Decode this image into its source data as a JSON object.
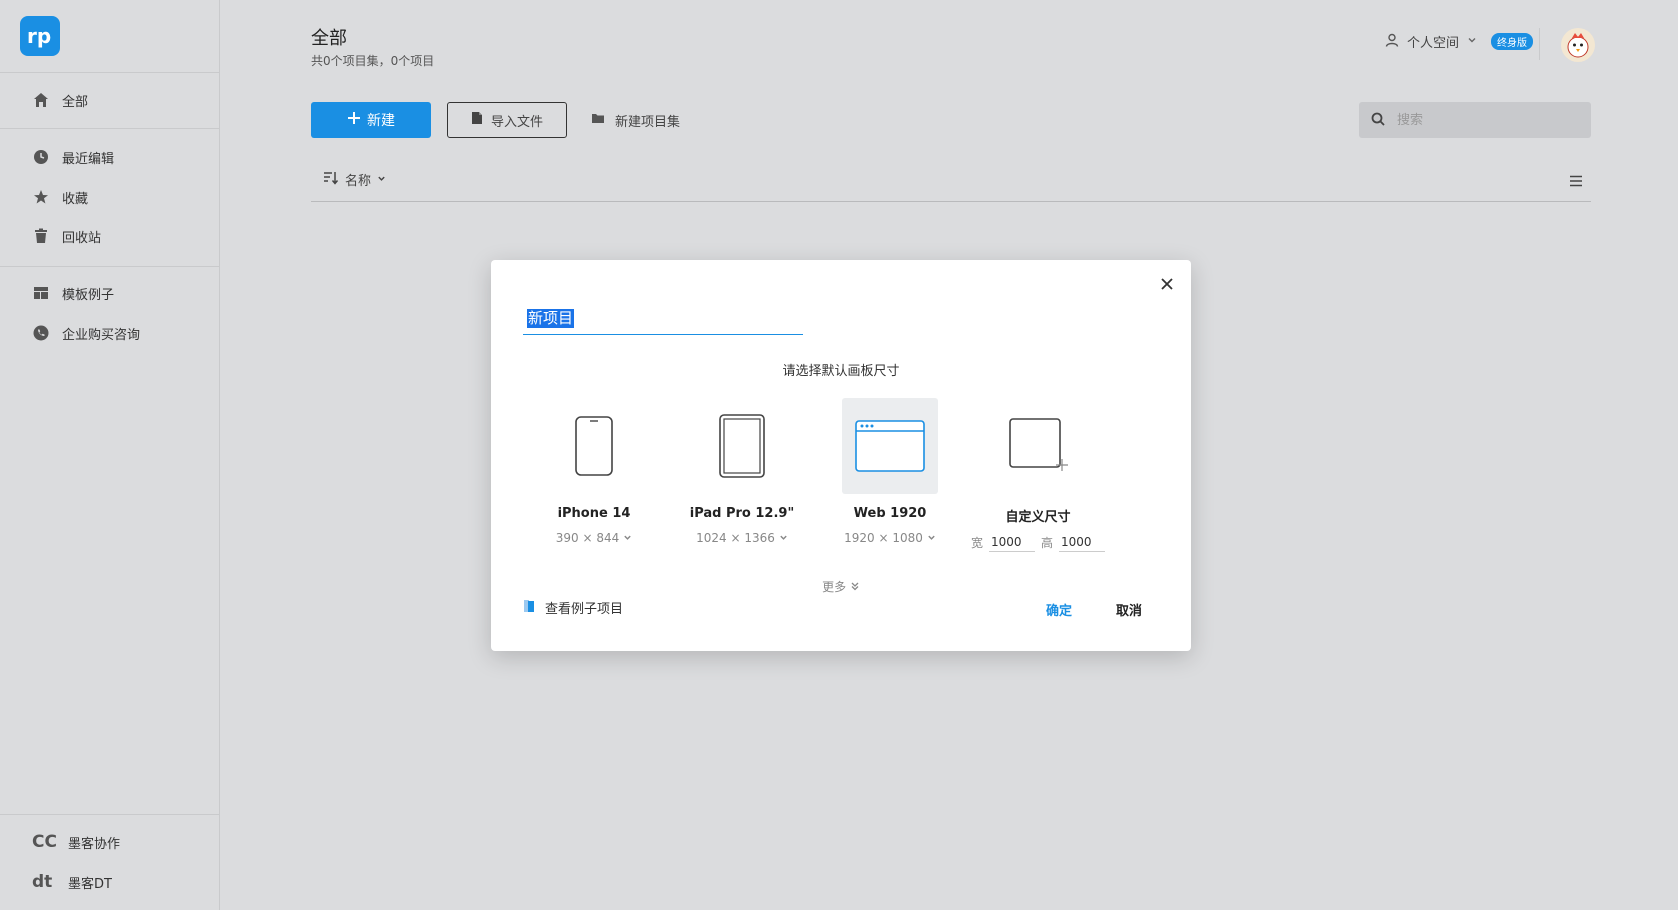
{
  "sidebar": {
    "items": [
      {
        "label": "全部",
        "icon": "home-icon"
      },
      {
        "label": "最近编辑",
        "icon": "clock-icon"
      },
      {
        "label": "收藏",
        "icon": "star-icon"
      },
      {
        "label": "回收站",
        "icon": "trash-icon"
      },
      {
        "label": "模板例子",
        "icon": "template-icon"
      },
      {
        "label": "企业购买咨询",
        "icon": "phone-icon"
      }
    ],
    "footer": [
      {
        "label": "墨客协作",
        "mark": "CC"
      },
      {
        "label": "墨客DT",
        "mark": "dt"
      }
    ]
  },
  "header": {
    "title": "全部",
    "subtitle": "共0个项目集，0个项目",
    "user_label": "个人空间",
    "badge": "终身版"
  },
  "toolbar": {
    "new_label": "新建",
    "import_label": "导入文件",
    "new_collection_label": "新建项目集",
    "search_placeholder": "搜索"
  },
  "sort": {
    "label": "名称"
  },
  "dialog": {
    "name_value": "新项目",
    "prompt": "请选择默认画板尺寸",
    "options": [
      {
        "label": "iPhone 14",
        "size": "390 × 844"
      },
      {
        "label": "iPad Pro 12.9\"",
        "size": "1024 × 1366"
      },
      {
        "label": "Web 1920",
        "size": "1920 × 1080"
      },
      {
        "label": "自定义尺寸",
        "width_label": "宽",
        "width": "1000",
        "height_label": "高",
        "height": "1000"
      }
    ],
    "more": "更多",
    "example": "查看例子项目",
    "ok": "确定",
    "cancel": "取消"
  },
  "colors": {
    "accent": "#1a8fe3",
    "background": "#dbdcde"
  }
}
